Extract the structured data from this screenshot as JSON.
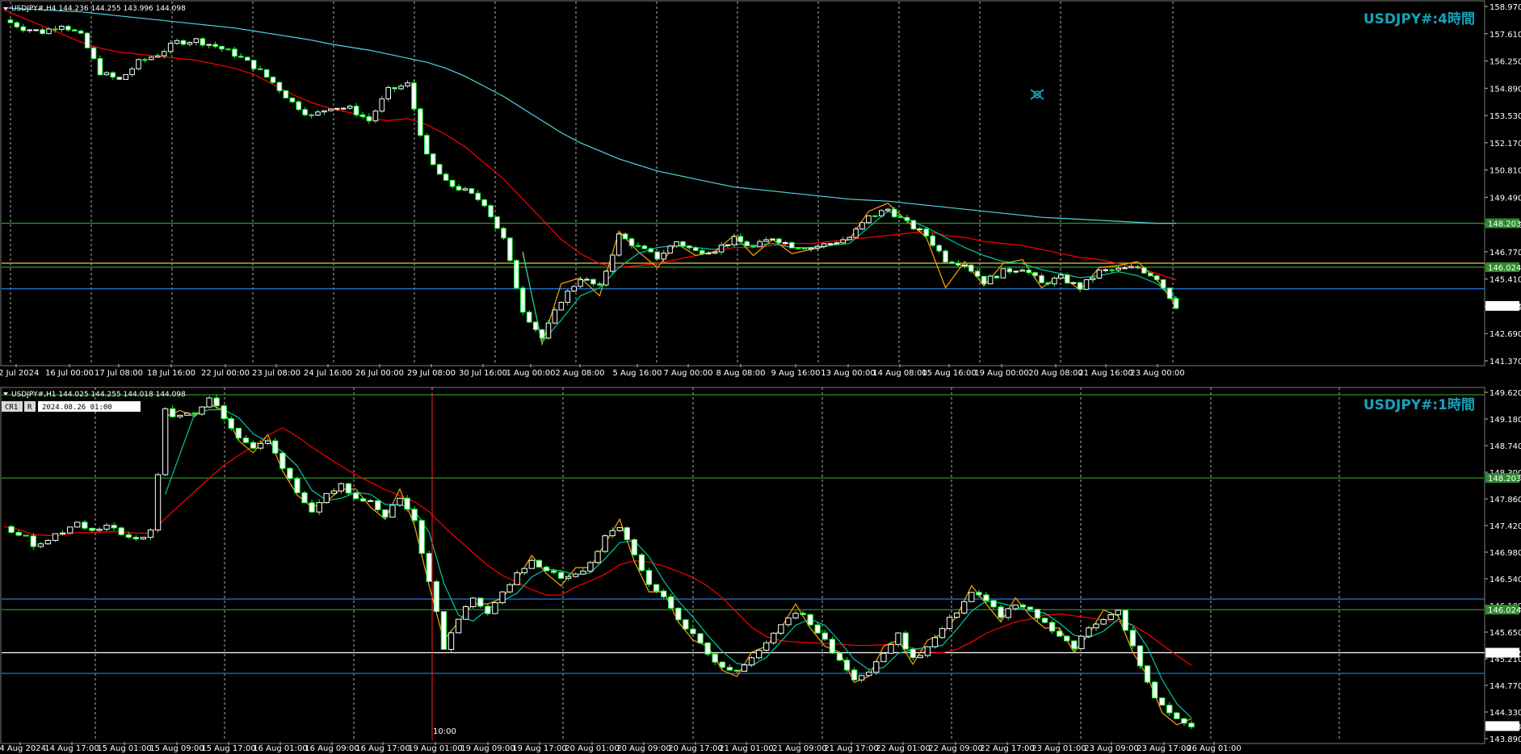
{
  "colors": {
    "background": "#000000",
    "bull_candle": "#ffffff",
    "bear_candle": "#ffffff",
    "candle_wick": "#1aff3a",
    "ma_red": "#ff0000",
    "ma_cyan": "#4fd6e0",
    "zigzag_orange": "#ffa500",
    "zigzag_teal": "#00c8a0",
    "level_green": "#2e8b2e",
    "level_yellow": "#e6c84a",
    "level_blue": "#1e6fd0",
    "level_white": "#ffffff",
    "crosshair_red": "#ff2020",
    "title_teal": "#17a2b8"
  },
  "chart_data": [
    {
      "type": "candlestick",
      "symbol_header": "USDJPY#,H4  144.236 144.255 143.996 144.098",
      "title": "USDJPY#:4時間",
      "ylim": [
        141.37,
        158.97
      ],
      "y_ticks": [
        "158.970",
        "157.610",
        "156.250",
        "154.890",
        "153.530",
        "152.170",
        "150.810",
        "149.490",
        "148.130",
        "146.770",
        "145.410",
        "144.050",
        "142.690",
        "141.370"
      ],
      "x_ticks": [
        "12 Jul 2024",
        "16 Jul 00:00",
        "17 Jul 08:00",
        "18 Jul 16:00",
        "22 Jul 00:00",
        "23 Jul 08:00",
        "24 Jul 16:00",
        "26 Jul 00:00",
        "29 Jul 08:00",
        "30 Jul 16:00",
        "1 Aug 00:00",
        "2 Aug 08:00",
        "5 Aug 16:00",
        "7 Aug 00:00",
        "8 Aug 08:00",
        "9 Aug 16:00",
        "13 Aug 00:00",
        "14 Aug 08:00",
        "15 Aug 16:00",
        "19 Aug 00:00",
        "20 Aug 08:00",
        "21 Aug 16:00",
        "23 Aug 00:00"
      ],
      "price_labels": [
        {
          "value": 148.203,
          "text": "148.203",
          "color": "level_green"
        },
        {
          "value": 146.024,
          "text": "146.024",
          "color": "level_green"
        },
        {
          "value": 144.098,
          "text": "144.098",
          "color": "level_white"
        }
      ],
      "levels": [
        {
          "value": 148.203,
          "color": "level_green"
        },
        {
          "value": 146.22,
          "color": "level_yellow"
        },
        {
          "value": 146.024,
          "color": "level_green"
        },
        {
          "value": 144.95,
          "color": "level_blue"
        }
      ],
      "close_path": [
        158.3,
        157.9,
        157.7,
        158.1,
        157.5,
        155.7,
        155.3,
        156.2,
        156.6,
        157.2,
        157.3,
        157.0,
        156.6,
        156.0,
        155.2,
        154.2,
        153.5,
        154.0,
        153.9,
        153.3,
        154.8,
        155.1,
        151.5,
        150.2,
        149.8,
        149.2,
        147.4,
        143.9,
        142.5,
        144.4,
        145.5,
        145.0,
        147.6,
        147.0,
        146.5,
        147.3,
        146.8,
        146.9,
        147.4,
        147.0,
        147.5,
        147.1,
        147.0,
        147.2,
        147.5,
        148.5,
        148.9,
        148.2,
        147.6,
        146.4,
        146.2,
        145.3,
        145.8,
        146.0,
        145.2,
        145.5,
        145.0,
        145.8,
        145.9,
        146.0,
        145.5,
        144.1
      ],
      "series": [
        {
          "name": "",
          "color": "ma_red",
          "values": [
            158.8,
            158.4,
            158.0,
            157.6,
            157.2,
            156.9,
            156.7,
            156.6,
            156.5,
            156.4,
            156.3,
            156.1,
            155.9,
            155.6,
            155.1,
            154.6,
            154.2,
            153.9,
            153.7,
            153.4,
            153.3,
            153.4,
            153.1,
            152.6,
            152.0,
            151.2,
            150.4,
            149.4,
            148.4,
            147.4,
            146.7,
            146.2,
            146.0,
            146.1,
            146.2,
            146.4,
            146.6,
            146.8,
            147.0,
            147.0,
            147.1,
            147.2,
            147.2,
            147.3,
            147.4,
            147.5,
            147.6,
            147.7,
            147.8,
            147.6,
            147.5,
            147.3,
            147.2,
            147.1,
            146.9,
            146.7,
            146.5,
            146.4,
            146.2,
            146.0,
            145.7,
            145.4
          ]
        },
        {
          "name": "",
          "color": "ma_cyan",
          "values": [
            158.9,
            158.85,
            158.8,
            158.75,
            158.7,
            158.6,
            158.5,
            158.4,
            158.3,
            158.2,
            158.1,
            158.0,
            157.9,
            157.75,
            157.6,
            157.45,
            157.3,
            157.1,
            156.95,
            156.8,
            156.6,
            156.4,
            156.2,
            155.9,
            155.5,
            155.0,
            154.5,
            153.9,
            153.3,
            152.7,
            152.2,
            151.8,
            151.4,
            151.1,
            150.8,
            150.6,
            150.4,
            150.2,
            150.0,
            149.9,
            149.8,
            149.7,
            149.6,
            149.5,
            149.4,
            149.35,
            149.3,
            149.2,
            149.1,
            149.0,
            148.9,
            148.8,
            148.7,
            148.6,
            148.5,
            148.45,
            148.4,
            148.35,
            148.3,
            148.25,
            148.2,
            148.2
          ]
        },
        {
          "name": "",
          "color": "zigzag_orange",
          "values": [
            null,
            null,
            null,
            null,
            null,
            null,
            null,
            null,
            null,
            null,
            null,
            null,
            null,
            null,
            null,
            null,
            null,
            null,
            null,
            null,
            null,
            null,
            null,
            null,
            null,
            null,
            null,
            146.8,
            142.2,
            145.2,
            145.5,
            144.6,
            147.8,
            146.8,
            146.0,
            147.2,
            146.6,
            146.8,
            147.6,
            146.6,
            147.4,
            146.7,
            146.9,
            147.1,
            147.4,
            148.8,
            149.2,
            148.3,
            147.5,
            145.0,
            146.3,
            145.1,
            146.2,
            146.4,
            145.0,
            145.6,
            144.9,
            146.0,
            146.1,
            146.3,
            145.4,
            144.1
          ]
        },
        {
          "name": "",
          "color": "zigzag_teal",
          "values": [
            null,
            null,
            null,
            null,
            null,
            null,
            null,
            null,
            null,
            null,
            null,
            null,
            null,
            null,
            null,
            null,
            null,
            null,
            null,
            null,
            null,
            null,
            null,
            null,
            null,
            null,
            null,
            146.7,
            142.3,
            143.4,
            144.6,
            145.0,
            146.0,
            146.7,
            147.0,
            147.1,
            147.0,
            146.9,
            147.2,
            147.1,
            147.2,
            147.0,
            147.0,
            147.1,
            147.2,
            148.0,
            148.8,
            148.4,
            148.0,
            147.5,
            147.0,
            146.6,
            146.3,
            146.2,
            145.9,
            145.7,
            145.5,
            145.6,
            145.8,
            145.6,
            145.2,
            144.5
          ]
        }
      ]
    },
    {
      "type": "candlestick",
      "symbol_header": "USDJPY#,H1  144.025 144.255 144.018 144.098",
      "title": "USDJPY#:1時間",
      "ylim": [
        143.89,
        149.62
      ],
      "y_ticks": [
        "149.620",
        "149.180",
        "148.740",
        "148.300",
        "147.860",
        "147.420",
        "146.980",
        "146.540",
        "146.100",
        "145.650",
        "145.210",
        "144.770",
        "144.330",
        "143.890"
      ],
      "x_ticks": [
        "14 Aug 2024",
        "14 Aug 17:00",
        "15 Aug 01:00",
        "15 Aug 09:00",
        "15 Aug 17:00",
        "16 Aug 01:00",
        "16 Aug 09:00",
        "16 Aug 17:00",
        "19 Aug 01:00",
        "19 Aug 09:00",
        "19 Aug 17:00",
        "20 Aug 01:00",
        "20 Aug 09:00",
        "20 Aug 17:00",
        "21 Aug 01:00",
        "21 Aug 09:00",
        "21 Aug 17:00",
        "22 Aug 01:00",
        "22 Aug 09:00",
        "22 Aug 17:00",
        "23 Aug 01:00",
        "23 Aug 09:00",
        "23 Aug 17:00",
        "26 Aug 01:00"
      ],
      "crosshair_box": {
        "tag1": "CR1",
        "tag2": "R",
        "datetime": "2024.08.26 01:00"
      },
      "crosshair_time": "10:00",
      "price_labels": [
        {
          "value": 148.203,
          "text": "148.203",
          "color": "level_green"
        },
        {
          "value": 146.024,
          "text": "146.024",
          "color": "level_green"
        },
        {
          "value": 145.312,
          "text": "145.312",
          "color": "level_white"
        },
        {
          "value": 144.098,
          "text": "144.098",
          "color": "level_white"
        }
      ],
      "levels": [
        {
          "value": 149.58,
          "color": "level_green"
        },
        {
          "value": 148.203,
          "color": "level_green"
        },
        {
          "value": 146.2,
          "color": "level_blue"
        },
        {
          "value": 146.024,
          "color": "level_green"
        },
        {
          "value": 145.312,
          "color": "level_white"
        },
        {
          "value": 144.97,
          "color": "level_blue"
        }
      ],
      "close_path": [
        147.4,
        147.3,
        147.1,
        147.2,
        147.3,
        147.5,
        147.3,
        147.4,
        147.3,
        147.2,
        147.3,
        149.3,
        149.2,
        149.3,
        149.5,
        149.2,
        148.9,
        148.7,
        148.8,
        148.4,
        148.0,
        147.6,
        147.9,
        148.1,
        147.9,
        147.8,
        147.6,
        147.9,
        147.5,
        146.5,
        145.4,
        145.9,
        146.2,
        146.0,
        146.3,
        146.6,
        146.8,
        146.7,
        146.5,
        146.6,
        146.8,
        147.2,
        147.4,
        146.9,
        146.4,
        146.2,
        145.9,
        145.6,
        145.3,
        145.1,
        145.0,
        145.2,
        145.5,
        145.8,
        146.0,
        145.8,
        145.5,
        145.2,
        144.9,
        145.0,
        145.3,
        145.6,
        145.2,
        145.4,
        145.7,
        146.0,
        146.3,
        146.2,
        145.9,
        146.1,
        146.0,
        145.8,
        145.6,
        145.4,
        145.7,
        145.9,
        146.0,
        145.4,
        144.8,
        144.4,
        144.2,
        144.1
      ]
    }
  ],
  "cursor_icon": "crosshair-cursor-icon"
}
